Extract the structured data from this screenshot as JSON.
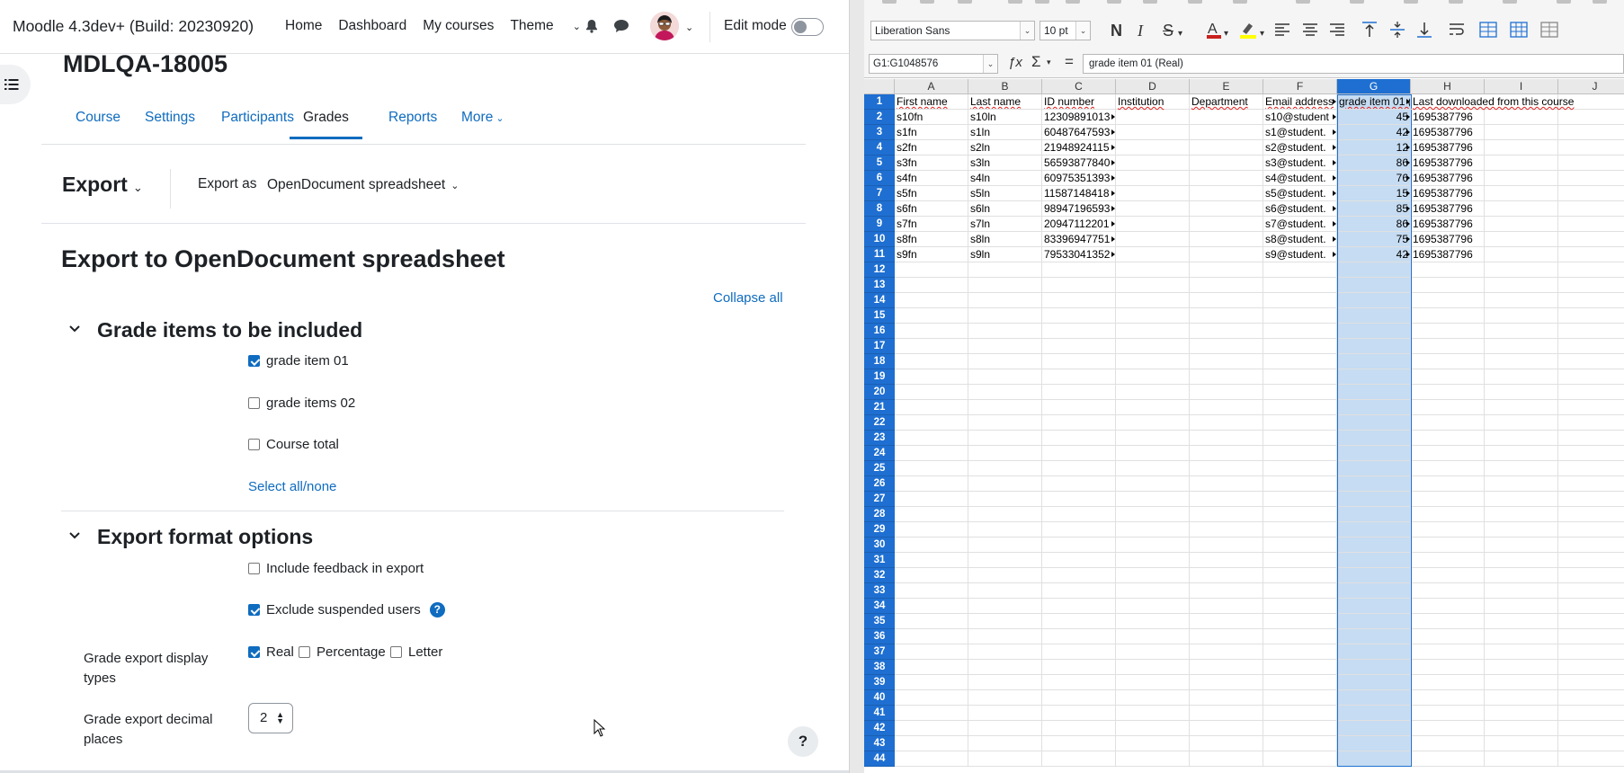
{
  "moodle": {
    "brand": "Moodle 4.3dev+ (Build: 20230920)",
    "nav_links": [
      "Home",
      "Dashboard",
      "My courses",
      "Theme"
    ],
    "edit_mode_label": "Edit mode",
    "course_title": "MDLQA-18005",
    "tabs": [
      "Course",
      "Settings",
      "Participants",
      "Grades",
      "Reports",
      "More"
    ],
    "active_tab": "Grades",
    "export": {
      "title": "Export",
      "export_as_label": "Export as",
      "format": "OpenDocument spreadsheet"
    },
    "page_heading": "Export to OpenDocument spreadsheet",
    "collapse_all": "Collapse all",
    "sections": {
      "grade_items": {
        "title": "Grade items to be included",
        "items": [
          {
            "label": "grade item 01",
            "checked": true
          },
          {
            "label": "grade items 02",
            "checked": false
          },
          {
            "label": "Course total",
            "checked": false
          }
        ],
        "select_all": "Select all/none"
      },
      "format_options": {
        "title": "Export format options",
        "include_feedback": {
          "label": "Include feedback in export",
          "checked": false
        },
        "exclude_suspended": {
          "label": "Exclude suspended users",
          "checked": true
        },
        "display_types_label": "Grade export display types",
        "display_types": [
          {
            "label": "Real",
            "checked": true
          },
          {
            "label": "Percentage",
            "checked": false
          },
          {
            "label": "Letter",
            "checked": false
          }
        ],
        "decimal_label": "Grade export decimal places",
        "decimal_value": "2"
      }
    },
    "help_button": "?",
    "colors": {
      "link": "#0f6cbf",
      "text": "#1d2125",
      "border": "#dee2e6"
    }
  },
  "calc": {
    "font_name": "Liberation Sans",
    "font_size": "10 pt",
    "name_box": "G1:G1048576",
    "formula_content": "grade item 01 (Real)",
    "format_buttons": [
      "N",
      "I",
      "S"
    ],
    "columns": [
      "A",
      "B",
      "C",
      "D",
      "E",
      "F",
      "G",
      "H",
      "I",
      "J"
    ],
    "selected_column": "G",
    "row_count_visible": 44,
    "header_row": [
      "First name",
      "Last name",
      "ID number",
      "Institution",
      "Department",
      "Email address",
      "grade item 01 (Real)",
      "Last downloaded from this course"
    ],
    "rows": [
      [
        "s10fn",
        "s10ln",
        "12309891013",
        "",
        "",
        "s10@student",
        "45",
        "1695387796"
      ],
      [
        "s1fn",
        "s1ln",
        "60487647593",
        "",
        "",
        "s1@student.",
        "42",
        "1695387796"
      ],
      [
        "s2fn",
        "s2ln",
        "21948924115",
        "",
        "",
        "s2@student.",
        "12",
        "1695387796"
      ],
      [
        "s3fn",
        "s3ln",
        "56593877840",
        "",
        "",
        "s3@student.",
        "86",
        "1695387796"
      ],
      [
        "s4fn",
        "s4ln",
        "60975351393",
        "",
        "",
        "s4@student.",
        "76",
        "1695387796"
      ],
      [
        "s5fn",
        "s5ln",
        "11587148418",
        "",
        "",
        "s5@student.",
        "15",
        "1695387796"
      ],
      [
        "s6fn",
        "s6ln",
        "98947196593",
        "",
        "",
        "s6@student.",
        "85",
        "1695387796"
      ],
      [
        "s7fn",
        "s7ln",
        "20947112201",
        "",
        "",
        "s7@student.",
        "86",
        "1695387796"
      ],
      [
        "s8fn",
        "s8ln",
        "83396947751",
        "",
        "",
        "s8@student.",
        "75",
        "1695387796"
      ],
      [
        "s9fn",
        "s9ln",
        "79533041352",
        "",
        "",
        "s9@student.",
        "42",
        "1695387796"
      ]
    ],
    "colors": {
      "selection": "#1e6fd1",
      "selected_fill": "#c6dcf2",
      "toolbar": "#f5f5f5"
    }
  }
}
